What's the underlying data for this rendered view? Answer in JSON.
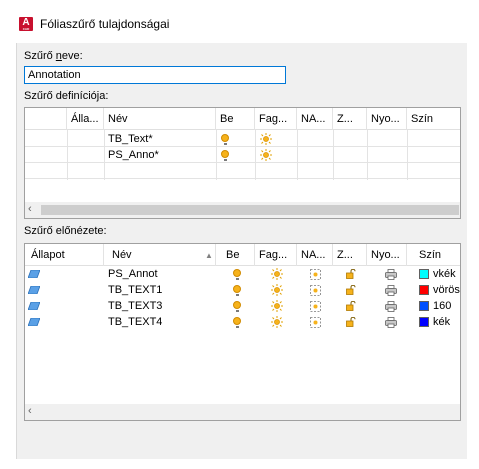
{
  "window": {
    "title": "Fóliaszűrő tulajdonságai",
    "icon_letter": "A",
    "icon_sub": "CAD"
  },
  "filter_name": {
    "label_pre": "Szűrő ",
    "label_u": "n",
    "label_post": "eve:",
    "value": "Annotation"
  },
  "definition": {
    "label": "Szűrő definíciója:",
    "columns": [
      "Álla...",
      "Név",
      "Be",
      "Fag...",
      "NA...",
      "Z...",
      "Nyo...",
      "Szín"
    ],
    "rows": [
      {
        "name": "TB_Text*",
        "on": true,
        "freeze": true
      },
      {
        "name": "PS_Anno*",
        "on": true,
        "freeze": true
      }
    ]
  },
  "preview": {
    "label": "Szűrő előnézete:",
    "columns": [
      "Állapot",
      "Név",
      "Be",
      "Fag...",
      "NA...",
      "Z...",
      "Nyo...",
      "Szín"
    ],
    "rows": [
      {
        "name": "PS_Annot",
        "color": "#00ffff",
        "color_name": "vkék"
      },
      {
        "name": "TB_TEXT1",
        "color": "#ff0000",
        "color_name": "vörös"
      },
      {
        "name": "TB_TEXT3",
        "color": "#0050ff",
        "color_name": "160"
      },
      {
        "name": "TB_TEXT4",
        "color": "#0000ff",
        "color_name": "kék"
      }
    ]
  },
  "icons": {
    "app": "autocad-icon",
    "on": "lightbulb-icon",
    "freeze": "sun-icon",
    "vp_freeze": "viewport-freeze-icon",
    "lock": "unlock-icon",
    "plot": "printer-icon",
    "status": "layer-icon"
  }
}
